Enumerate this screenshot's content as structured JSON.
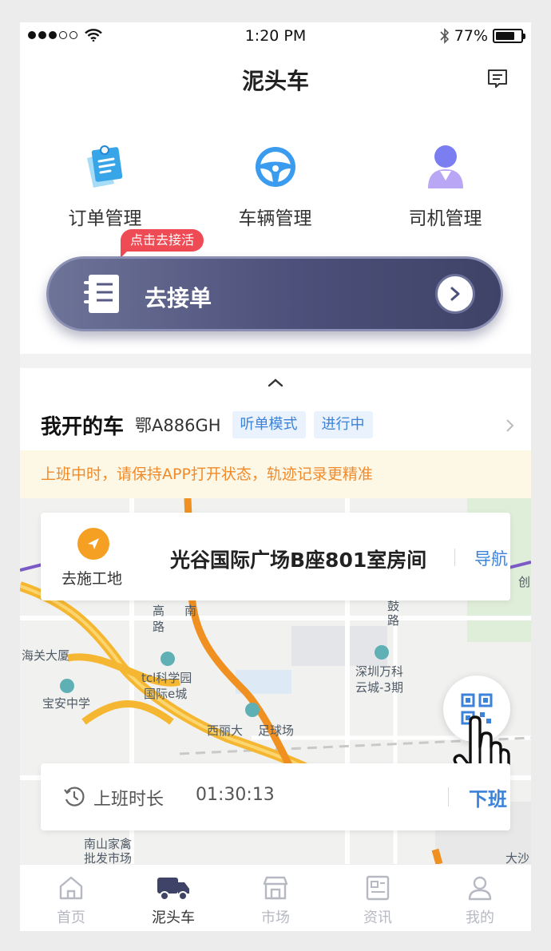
{
  "status_bar": {
    "time": "1:20 PM",
    "battery": "77%",
    "battery_level": 0.77,
    "signal_bars": 3
  },
  "header": {
    "title": "泥头车",
    "message_icon": "message-icon"
  },
  "quick_menu": [
    {
      "label": "订单管理",
      "icon": "order-clipboard-icon"
    },
    {
      "label": "车辆管理",
      "icon": "steering-wheel-icon"
    },
    {
      "label": "司机管理",
      "icon": "driver-person-icon"
    }
  ],
  "grab_order": {
    "hint": "点击去接活",
    "label": "去接单"
  },
  "my_car": {
    "title": "我开的车",
    "plate": "鄂A886GH",
    "tags": [
      "听单模式",
      "进行中"
    ]
  },
  "notice": "上班中时，请保持APP打开状态，轨迹记录更精准",
  "map": {
    "labels": [
      "海关大厦",
      "宝安中学",
      "tcl科学园",
      "国际e城",
      "深圳万科",
      "云城-3期",
      "西丽大",
      "足球场",
      "南山家禽",
      "批发市场",
      "大沙",
      "创",
      "鼓",
      "路",
      "高",
      "南",
      "路"
    ]
  },
  "destination": {
    "type_label": "去施工地",
    "address": "光谷国际广场B座801室房间",
    "nav_label": "导航"
  },
  "shift": {
    "label": "上班时长",
    "duration": "01:30:13",
    "off_label": "下班"
  },
  "tabs": [
    {
      "label": "首页",
      "icon": "home-icon",
      "active": false
    },
    {
      "label": "泥头车",
      "icon": "truck-icon",
      "active": true
    },
    {
      "label": "市场",
      "icon": "store-icon",
      "active": false
    },
    {
      "label": "资讯",
      "icon": "news-icon",
      "active": false
    },
    {
      "label": "我的",
      "icon": "profile-icon",
      "active": false
    }
  ],
  "colors": {
    "accent_blue": "#3b82d8",
    "notice_orange": "#f08a2a",
    "route_yellow": "#f5b731",
    "grab_button": "#4c507a"
  }
}
